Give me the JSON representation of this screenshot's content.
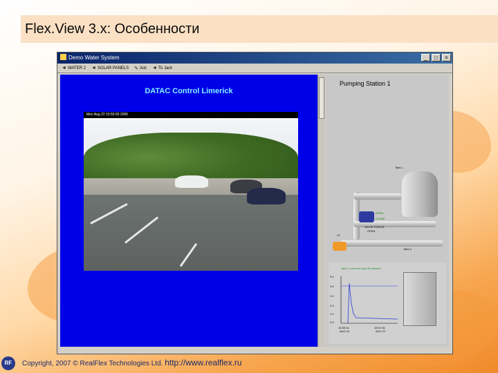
{
  "slide": {
    "title": "Flex.View 3.x: Особенности",
    "footer_copyright": "Copyright, 2007 © RealFlex Technologies Ltd.",
    "footer_url": "http://www.realflex.ru",
    "logo_text": "RF"
  },
  "window": {
    "title": "Demo Water System",
    "buttons": [
      "_",
      "□",
      "×"
    ],
    "toolbar": [
      {
        "icon": "back-arrow-icon",
        "label": "WATER 2"
      },
      {
        "icon": "back-arrow-icon",
        "label": "SOLAR PANELS"
      },
      {
        "icon": "ack-icon",
        "label": "Ack"
      },
      {
        "icon": "back-arrow-icon",
        "label": "To Jack"
      }
    ]
  },
  "left_panel": {
    "heading": "DATAC Control Limerick",
    "timestamp": "Mon Aug 22 15:55:55 2005"
  },
  "right_panel": {
    "title": "Pumping Station 1",
    "labels": {
      "tank1": "Tank 1",
      "tank2": "Tank 2",
      "open": "OPEN",
      "close": "CLOSE",
      "valve_status": "VALVE STATUS",
      "valve_tag": "OPEN",
      "valve_left": "V1"
    },
    "chart": {
      "header": "Tank 1 Level for past 30 minutes",
      "y_ticks": [
        "5.0",
        "4.0",
        "3.0",
        "2.0",
        "1.0",
        "0.0"
      ],
      "x_ticks": [
        {
          "time": "15:35:14",
          "date": "AUG 22"
        },
        {
          "time": "15:57:36",
          "date": "AUG 22"
        }
      ]
    }
  },
  "colors": {
    "panel_blue": "#0000e8",
    "heading_cyan": "#7ff0ff",
    "title_band": "#fbe0c4",
    "titlebar_blue": "#0a246a",
    "valve_orange": "#f19a2a"
  }
}
